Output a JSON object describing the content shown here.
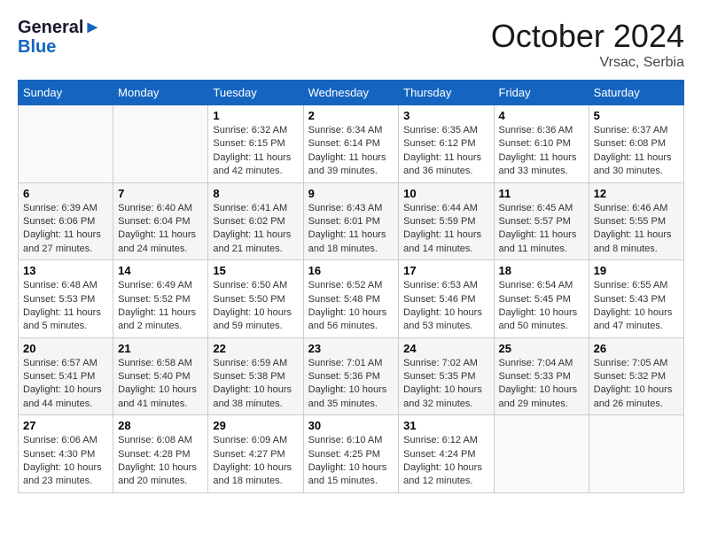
{
  "header": {
    "logo_line1": "General",
    "logo_line2": "Blue",
    "month": "October 2024",
    "location": "Vrsac, Serbia"
  },
  "weekdays": [
    "Sunday",
    "Monday",
    "Tuesday",
    "Wednesday",
    "Thursday",
    "Friday",
    "Saturday"
  ],
  "weeks": [
    [
      {
        "day": "",
        "info": ""
      },
      {
        "day": "",
        "info": ""
      },
      {
        "day": "1",
        "info": "Sunrise: 6:32 AM\nSunset: 6:15 PM\nDaylight: 11 hours and 42 minutes."
      },
      {
        "day": "2",
        "info": "Sunrise: 6:34 AM\nSunset: 6:14 PM\nDaylight: 11 hours and 39 minutes."
      },
      {
        "day": "3",
        "info": "Sunrise: 6:35 AM\nSunset: 6:12 PM\nDaylight: 11 hours and 36 minutes."
      },
      {
        "day": "4",
        "info": "Sunrise: 6:36 AM\nSunset: 6:10 PM\nDaylight: 11 hours and 33 minutes."
      },
      {
        "day": "5",
        "info": "Sunrise: 6:37 AM\nSunset: 6:08 PM\nDaylight: 11 hours and 30 minutes."
      }
    ],
    [
      {
        "day": "6",
        "info": "Sunrise: 6:39 AM\nSunset: 6:06 PM\nDaylight: 11 hours and 27 minutes."
      },
      {
        "day": "7",
        "info": "Sunrise: 6:40 AM\nSunset: 6:04 PM\nDaylight: 11 hours and 24 minutes."
      },
      {
        "day": "8",
        "info": "Sunrise: 6:41 AM\nSunset: 6:02 PM\nDaylight: 11 hours and 21 minutes."
      },
      {
        "day": "9",
        "info": "Sunrise: 6:43 AM\nSunset: 6:01 PM\nDaylight: 11 hours and 18 minutes."
      },
      {
        "day": "10",
        "info": "Sunrise: 6:44 AM\nSunset: 5:59 PM\nDaylight: 11 hours and 14 minutes."
      },
      {
        "day": "11",
        "info": "Sunrise: 6:45 AM\nSunset: 5:57 PM\nDaylight: 11 hours and 11 minutes."
      },
      {
        "day": "12",
        "info": "Sunrise: 6:46 AM\nSunset: 5:55 PM\nDaylight: 11 hours and 8 minutes."
      }
    ],
    [
      {
        "day": "13",
        "info": "Sunrise: 6:48 AM\nSunset: 5:53 PM\nDaylight: 11 hours and 5 minutes."
      },
      {
        "day": "14",
        "info": "Sunrise: 6:49 AM\nSunset: 5:52 PM\nDaylight: 11 hours and 2 minutes."
      },
      {
        "day": "15",
        "info": "Sunrise: 6:50 AM\nSunset: 5:50 PM\nDaylight: 10 hours and 59 minutes."
      },
      {
        "day": "16",
        "info": "Sunrise: 6:52 AM\nSunset: 5:48 PM\nDaylight: 10 hours and 56 minutes."
      },
      {
        "day": "17",
        "info": "Sunrise: 6:53 AM\nSunset: 5:46 PM\nDaylight: 10 hours and 53 minutes."
      },
      {
        "day": "18",
        "info": "Sunrise: 6:54 AM\nSunset: 5:45 PM\nDaylight: 10 hours and 50 minutes."
      },
      {
        "day": "19",
        "info": "Sunrise: 6:55 AM\nSunset: 5:43 PM\nDaylight: 10 hours and 47 minutes."
      }
    ],
    [
      {
        "day": "20",
        "info": "Sunrise: 6:57 AM\nSunset: 5:41 PM\nDaylight: 10 hours and 44 minutes."
      },
      {
        "day": "21",
        "info": "Sunrise: 6:58 AM\nSunset: 5:40 PM\nDaylight: 10 hours and 41 minutes."
      },
      {
        "day": "22",
        "info": "Sunrise: 6:59 AM\nSunset: 5:38 PM\nDaylight: 10 hours and 38 minutes."
      },
      {
        "day": "23",
        "info": "Sunrise: 7:01 AM\nSunset: 5:36 PM\nDaylight: 10 hours and 35 minutes."
      },
      {
        "day": "24",
        "info": "Sunrise: 7:02 AM\nSunset: 5:35 PM\nDaylight: 10 hours and 32 minutes."
      },
      {
        "day": "25",
        "info": "Sunrise: 7:04 AM\nSunset: 5:33 PM\nDaylight: 10 hours and 29 minutes."
      },
      {
        "day": "26",
        "info": "Sunrise: 7:05 AM\nSunset: 5:32 PM\nDaylight: 10 hours and 26 minutes."
      }
    ],
    [
      {
        "day": "27",
        "info": "Sunrise: 6:06 AM\nSunset: 4:30 PM\nDaylight: 10 hours and 23 minutes."
      },
      {
        "day": "28",
        "info": "Sunrise: 6:08 AM\nSunset: 4:28 PM\nDaylight: 10 hours and 20 minutes."
      },
      {
        "day": "29",
        "info": "Sunrise: 6:09 AM\nSunset: 4:27 PM\nDaylight: 10 hours and 18 minutes."
      },
      {
        "day": "30",
        "info": "Sunrise: 6:10 AM\nSunset: 4:25 PM\nDaylight: 10 hours and 15 minutes."
      },
      {
        "day": "31",
        "info": "Sunrise: 6:12 AM\nSunset: 4:24 PM\nDaylight: 10 hours and 12 minutes."
      },
      {
        "day": "",
        "info": ""
      },
      {
        "day": "",
        "info": ""
      }
    ]
  ]
}
